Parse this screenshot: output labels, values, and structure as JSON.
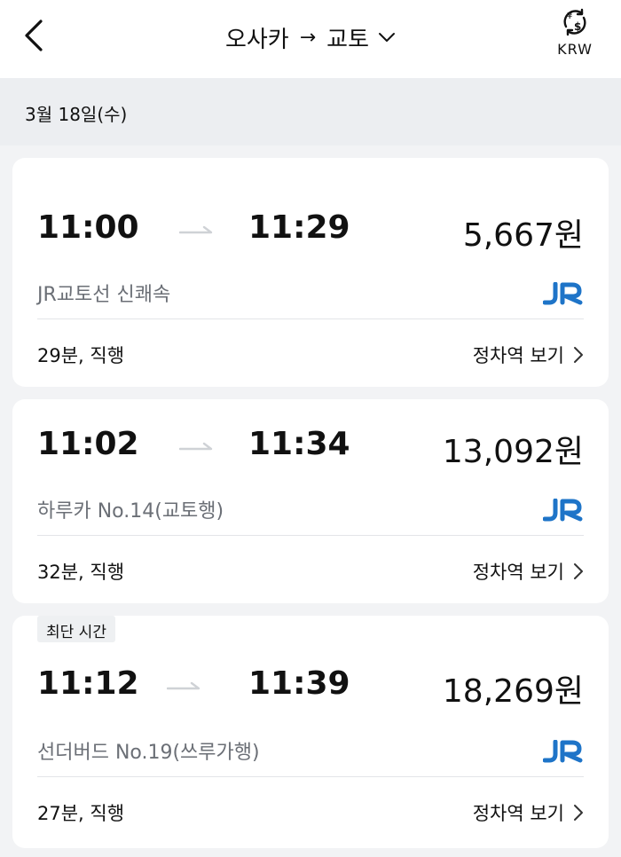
{
  "header": {
    "from": "오사카",
    "arrow": "→",
    "to": "교토",
    "currency": "KRW"
  },
  "date": "3월 18일(수)",
  "results": [
    {
      "badge": "",
      "departure": "11:00",
      "arrival": "11:29",
      "price": "5,667원",
      "train": "JR교토선 신쾌속",
      "operator_icon": "jr-logo-icon",
      "duration": "29분, 직행",
      "stops_label": "정차역 보기"
    },
    {
      "badge": "",
      "departure": "11:02",
      "arrival": "11:34",
      "price": "13,092원",
      "train": "하루카 No.14(교토행)",
      "operator_icon": "jr-logo-icon",
      "duration": "32분, 직행",
      "stops_label": "정차역 보기"
    },
    {
      "badge": "최단 시간",
      "departure": "11:12",
      "arrival": "11:39",
      "price": "18,269원",
      "train": "선더버드 No.19(쓰루가행)",
      "operator_icon": "jr-logo-icon",
      "duration": "27분, 직행",
      "stops_label": "정차역 보기"
    }
  ],
  "colors": {
    "jr_blue": "#1e74c8",
    "secondary_text": "#6b6f76",
    "background": "#f2f3f5"
  }
}
